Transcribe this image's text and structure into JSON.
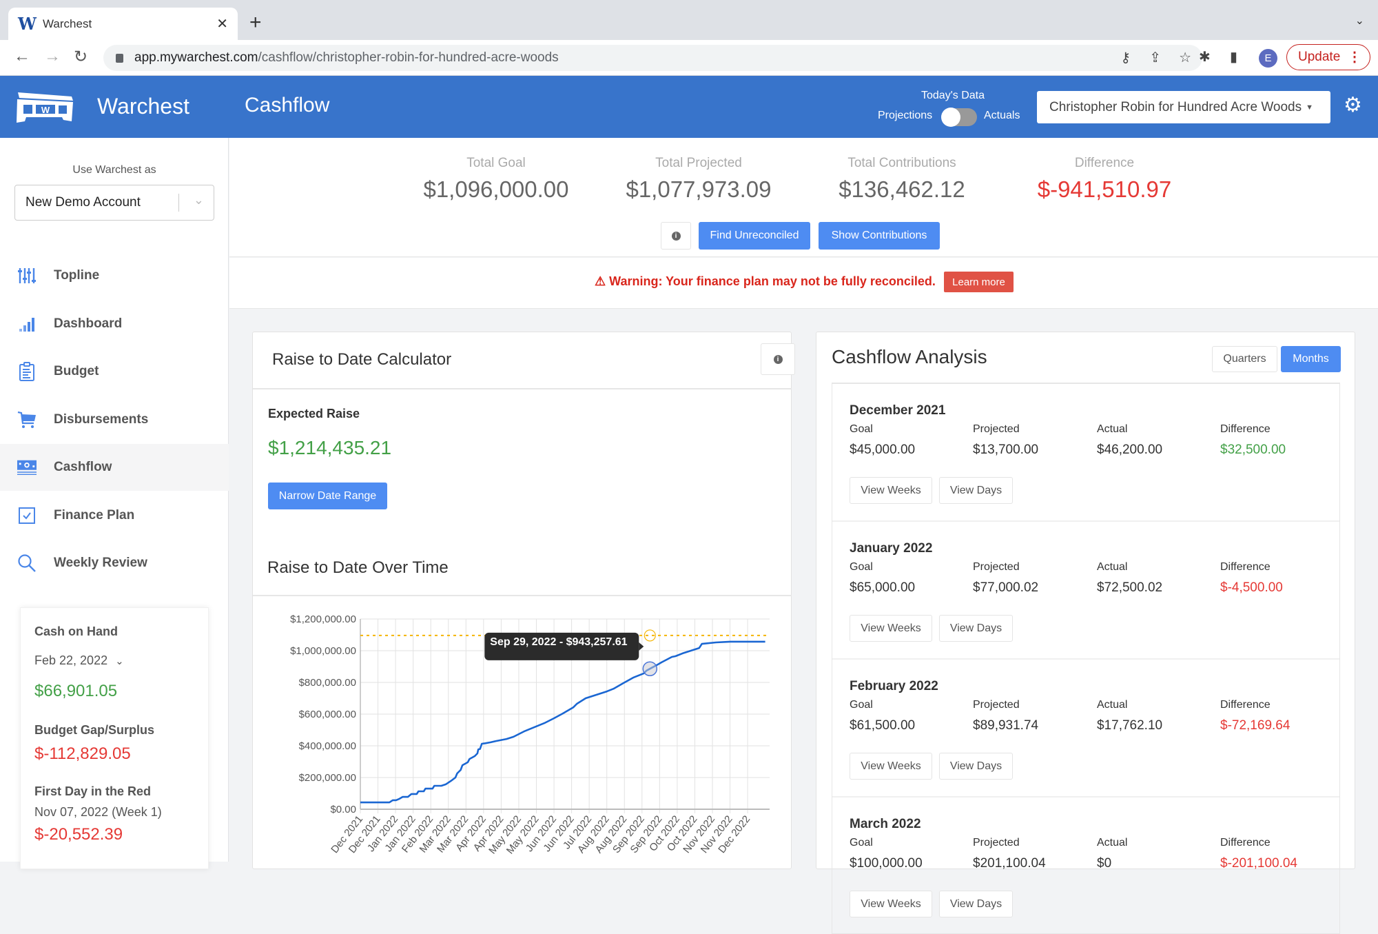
{
  "browser": {
    "tab_title": "Warchest",
    "tab_favicon": "W",
    "url_host": "app.mywarchest.com",
    "url_path": "/cashflow/christopher-robin-for-hundred-acre-woods",
    "profile_initial": "E",
    "update_label": "Update"
  },
  "header": {
    "brand": "Warchest",
    "page_title": "Cashflow",
    "todays_data_label": "Today's Data",
    "projections_label": "Projections",
    "actuals_label": "Actuals",
    "toggle_state": "projections",
    "campaign_select": "Christopher Robin for Hundred Acre Woods",
    "accent_color": "#3874cb"
  },
  "sidebar": {
    "use_as_label": "Use Warchest as",
    "account_select": "New Demo Account",
    "items": [
      {
        "label": "Topline",
        "icon": "sliders-icon"
      },
      {
        "label": "Dashboard",
        "icon": "bar-chart-icon"
      },
      {
        "label": "Budget",
        "icon": "clipboard-icon"
      },
      {
        "label": "Disbursements",
        "icon": "cart-icon"
      },
      {
        "label": "Cashflow",
        "icon": "money-icon",
        "active": true
      },
      {
        "label": "Finance Plan",
        "icon": "checkbox-icon"
      },
      {
        "label": "Weekly Review",
        "icon": "search-icon"
      }
    ],
    "cash_card": {
      "cash_on_hand_label": "Cash on Hand",
      "date": "Feb 22, 2022",
      "cash_on_hand": "$66,901.05",
      "budget_gap_label": "Budget Gap/Surplus",
      "budget_gap": "$-112,829.05",
      "first_red_label": "First Day in the Red",
      "first_red_date": "Nov 07, 2022 (Week 1)",
      "first_red_value": "$-20,552.39"
    }
  },
  "summary": {
    "stats": [
      {
        "label": "Total Goal",
        "value": "$1,096,000.00"
      },
      {
        "label": "Total Projected",
        "value": "$1,077,973.09"
      },
      {
        "label": "Total Contributions",
        "value": "$136,462.12"
      },
      {
        "label": "Difference",
        "value": "$-941,510.97"
      }
    ],
    "find_unreconciled": "Find Unreconciled",
    "show_contributions": "Show Contributions",
    "warning": "⚠ Warning: Your finance plan may not be fully reconciled.",
    "learn_more": "Learn more"
  },
  "raise_calc": {
    "title": "Raise to Date Calculator",
    "expected_label": "Expected Raise",
    "expected_value": "$1,214,435.21",
    "narrow_button": "Narrow Date Range",
    "chart_title": "Raise to Date Over Time"
  },
  "chart_data": {
    "type": "line",
    "title": "Raise to Date Over Time",
    "xlabel": "",
    "ylabel": "",
    "ylim": [
      0,
      1200000
    ],
    "yticks": [
      "$0.00",
      "$200,000.00",
      "$400,000.00",
      "$600,000.00",
      "$800,000.00",
      "$1,000,000.00",
      "$1,200,000.00"
    ],
    "ytick_values": [
      0,
      200000,
      400000,
      600000,
      800000,
      1000000,
      1200000
    ],
    "categories": [
      "Dec 2021",
      "Dec 2021",
      "Jan 2022",
      "Jan 2022",
      "Feb 2022",
      "Mar 2022",
      "Mar 2022",
      "Apr 2022",
      "Apr 2022",
      "May 2022",
      "May 2022",
      "Jun 2022",
      "Jun 2022",
      "Jul 2022",
      "Aug 2022",
      "Aug 2022",
      "Sep 2022",
      "Sep 2022",
      "Oct 2022",
      "Oct 2022",
      "Nov 2022",
      "Nov 2022",
      "Dec 2022"
    ],
    "grid": true,
    "goal_line": {
      "value": 1096000,
      "color": "#f4b400",
      "style": "dotted"
    },
    "series": [
      {
        "name": "Raise to Date",
        "color": "#1a66d2",
        "points": [
          [
            0,
            43000
          ],
          [
            1.65,
            43000
          ],
          [
            1.84,
            57000
          ],
          [
            2.03,
            57000
          ],
          [
            2.2,
            65000
          ],
          [
            2.4,
            78000
          ],
          [
            2.7,
            78000
          ],
          [
            2.9,
            96000
          ],
          [
            3.2,
            96000
          ],
          [
            3.3,
            113000
          ],
          [
            3.6,
            113000
          ],
          [
            3.7,
            130000
          ],
          [
            4.1,
            130000
          ],
          [
            4.2,
            148000
          ],
          [
            4.6,
            148000
          ],
          [
            4.85,
            157000
          ],
          [
            5.2,
            183000
          ],
          [
            5.4,
            200000
          ],
          [
            5.5,
            226000
          ],
          [
            5.7,
            248000
          ],
          [
            5.8,
            278000
          ],
          [
            6.1,
            296000
          ],
          [
            6.2,
            317000
          ],
          [
            6.5,
            335000
          ],
          [
            6.65,
            352000
          ],
          [
            6.7,
            378000
          ],
          [
            6.8,
            380000
          ],
          [
            6.9,
            413000
          ],
          [
            7.1,
            416000
          ],
          [
            7.4,
            422000
          ],
          [
            7.7,
            430000
          ],
          [
            8.3,
            443000
          ],
          [
            8.7,
            457000
          ],
          [
            9.3,
            491000
          ],
          [
            10.45,
            543000
          ],
          [
            11.0,
            574000
          ],
          [
            11.5,
            604000
          ],
          [
            12.1,
            643000
          ],
          [
            12.3,
            665000
          ],
          [
            12.8,
            700000
          ],
          [
            14.0,
            743000
          ],
          [
            14.4,
            761000
          ],
          [
            14.95,
            796000
          ],
          [
            15.5,
            830000
          ],
          [
            16.1,
            857000
          ],
          [
            16.25,
            874000
          ],
          [
            16.45,
            886000
          ],
          [
            16.9,
            913000
          ],
          [
            17.1,
            926000
          ],
          [
            17.7,
            961000
          ],
          [
            17.9,
            965000
          ],
          [
            18.3,
            983000
          ],
          [
            19.25,
            1017000
          ],
          [
            19.4,
            1043000
          ],
          [
            20.2,
            1052000
          ],
          [
            21.0,
            1057000
          ],
          [
            23.0,
            1057000
          ]
        ]
      }
    ],
    "tooltip": {
      "x_index": 16.45,
      "text": "Sep 29, 2022 - $943,257.61"
    },
    "legend": "none"
  },
  "cashflow": {
    "title": "Cashflow Analysis",
    "quarters_label": "Quarters",
    "months_label": "Months",
    "selected": "Months",
    "col_labels": [
      "Goal",
      "Projected",
      "Actual",
      "Difference"
    ],
    "view_weeks": "View Weeks",
    "view_days": "View Days",
    "months": [
      {
        "name": "December 2021",
        "goal": "$45,000.00",
        "projected": "$13,700.00",
        "actual": "$46,200.00",
        "difference": "$32,500.00",
        "diff_status": "positive"
      },
      {
        "name": "January 2022",
        "goal": "$65,000.00",
        "projected": "$77,000.02",
        "actual": "$72,500.02",
        "difference": "$-4,500.00",
        "diff_status": "negative"
      },
      {
        "name": "February 2022",
        "goal": "$61,500.00",
        "projected": "$89,931.74",
        "actual": "$17,762.10",
        "difference": "$-72,169.64",
        "diff_status": "negative"
      },
      {
        "name": "March 2022",
        "goal": "$100,000.00",
        "projected": "$201,100.04",
        "actual": "$0",
        "difference": "$-201,100.04",
        "diff_status": "negative"
      }
    ]
  }
}
